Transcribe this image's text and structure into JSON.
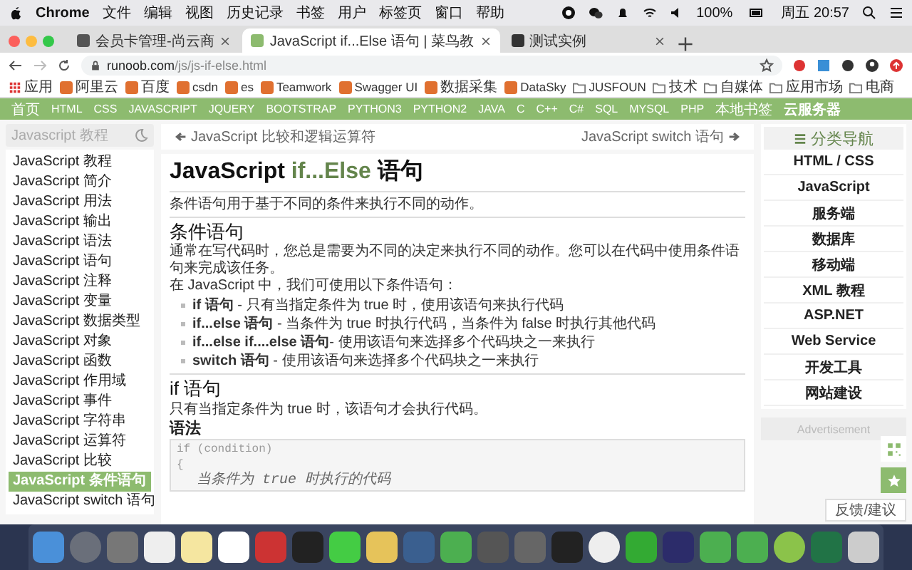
{
  "menubar": {
    "app": "Chrome",
    "menus": [
      "文件",
      "编辑",
      "视图",
      "历史记录",
      "书签",
      "用户",
      "标签页",
      "窗口",
      "帮助"
    ],
    "battery": "100%",
    "clock": "周五 20:57"
  },
  "tabs": [
    {
      "title": "会员卡管理-尚云商",
      "selected": false
    },
    {
      "title": "JavaScript if...Else 语句 | 菜鸟教",
      "selected": true
    },
    {
      "title": "测试实例",
      "selected": false
    }
  ],
  "address": {
    "host": "runoob.com",
    "path": "/js/js-if-else.html"
  },
  "bookmarks": [
    {
      "label": "应用",
      "kind": "apps"
    },
    {
      "label": "阿里云",
      "kind": "site"
    },
    {
      "label": "百度",
      "kind": "site"
    },
    {
      "label": "csdn",
      "kind": "site"
    },
    {
      "label": "es",
      "kind": "site"
    },
    {
      "label": "Teamwork",
      "kind": "site"
    },
    {
      "label": "Swagger UI",
      "kind": "site"
    },
    {
      "label": "数据采集",
      "kind": "site"
    },
    {
      "label": "DataSky",
      "kind": "site"
    },
    {
      "label": "JUSFOUN",
      "kind": "folder"
    },
    {
      "label": "技术",
      "kind": "folder"
    },
    {
      "label": "自媒体",
      "kind": "folder"
    },
    {
      "label": "应用市场",
      "kind": "folder"
    },
    {
      "label": "电商",
      "kind": "folder"
    }
  ],
  "nav": [
    {
      "label": "首页",
      "emphasized": false
    },
    {
      "label": "HTML",
      "emphasized": false
    },
    {
      "label": "CSS",
      "emphasized": false
    },
    {
      "label": "JAVASCRIPT",
      "emphasized": false
    },
    {
      "label": "JQUERY",
      "emphasized": false
    },
    {
      "label": "BOOTSTRAP",
      "emphasized": false
    },
    {
      "label": "PYTHON3",
      "emphasized": false
    },
    {
      "label": "PYTHON2",
      "emphasized": false
    },
    {
      "label": "JAVA",
      "emphasized": false
    },
    {
      "label": "C",
      "emphasized": false
    },
    {
      "label": "C++",
      "emphasized": false
    },
    {
      "label": "C#",
      "emphasized": false
    },
    {
      "label": "SQL",
      "emphasized": false
    },
    {
      "label": "MYSQL",
      "emphasized": false
    },
    {
      "label": "PHP",
      "emphasized": false
    },
    {
      "label": "本地书签",
      "emphasized": false
    },
    {
      "label": "云服务器",
      "emphasized": true
    }
  ],
  "sidebar": {
    "placeholder": "Javascript 教程",
    "items": [
      {
        "label": "JavaScript 教程",
        "selected": false
      },
      {
        "label": "JavaScript 简介",
        "selected": false
      },
      {
        "label": "JavaScript 用法",
        "selected": false
      },
      {
        "label": "JavaScript 输出",
        "selected": false
      },
      {
        "label": "JavaScript 语法",
        "selected": false
      },
      {
        "label": "JavaScript 语句",
        "selected": false
      },
      {
        "label": "JavaScript 注释",
        "selected": false
      },
      {
        "label": "JavaScript 变量",
        "selected": false
      },
      {
        "label": "JavaScript 数据类型",
        "selected": false
      },
      {
        "label": "JavaScript 对象",
        "selected": false
      },
      {
        "label": "JavaScript 函数",
        "selected": false
      },
      {
        "label": "JavaScript 作用域",
        "selected": false
      },
      {
        "label": "JavaScript 事件",
        "selected": false
      },
      {
        "label": "JavaScript 字符串",
        "selected": false
      },
      {
        "label": "JavaScript 运算符",
        "selected": false
      },
      {
        "label": "JavaScript 比较",
        "selected": false
      },
      {
        "label": "JavaScript 条件语句",
        "selected": true
      },
      {
        "label": "JavaScript switch 语句",
        "selected": false
      }
    ]
  },
  "article": {
    "prev": "JavaScript 比较和逻辑运算符",
    "next": "JavaScript switch 语句",
    "title": {
      "before": "JavaScript ",
      "highlight": "if...Else",
      "after": " 语句"
    },
    "intro": "条件语句用于基于不同的条件来执行不同的动作。",
    "section_1": {
      "heading": "条件语句",
      "paragraphs": [
        "通常在写代码时，您总是需要为不同的决定来执行不同的动作。您可以在代码中使用条件语句来完成该任务。",
        "在 JavaScript 中，我们可使用以下条件语句："
      ],
      "bullets": [
        "**if 语句** - 只有当指定条件为 true 时，使用该语句来执行代码",
        "**if...else 语句** - 当条件为 true 时执行代码，当条件为 false 时执行其他代码",
        "**if...else if....else 语句**- 使用该语句来选择多个代码块之一来执行",
        "**switch 语句** - 使用该语句来选择多个代码块之一来执行"
      ]
    },
    "section_2": {
      "heading": "if 语句",
      "paragraph": "只有当指定条件为 true 时，该语句才会执行代码。",
      "subheading": "语法",
      "code": [
        {
          "text": "if (condition)",
          "kind": "code"
        },
        {
          "text": "{",
          "kind": "code"
        },
        {
          "text": "当条件为 true 时执行的代码",
          "kind": "comment"
        }
      ]
    }
  },
  "category_nav": {
    "title": "分类导航",
    "items": [
      "HTML / CSS",
      "JavaScript",
      "服务端",
      "数据库",
      "移动端",
      "XML 教程",
      "ASP.NET",
      "Web Service",
      "开发工具",
      "网站建设"
    ]
  },
  "advertisement": "Advertisement",
  "feedback": "反馈/建议"
}
